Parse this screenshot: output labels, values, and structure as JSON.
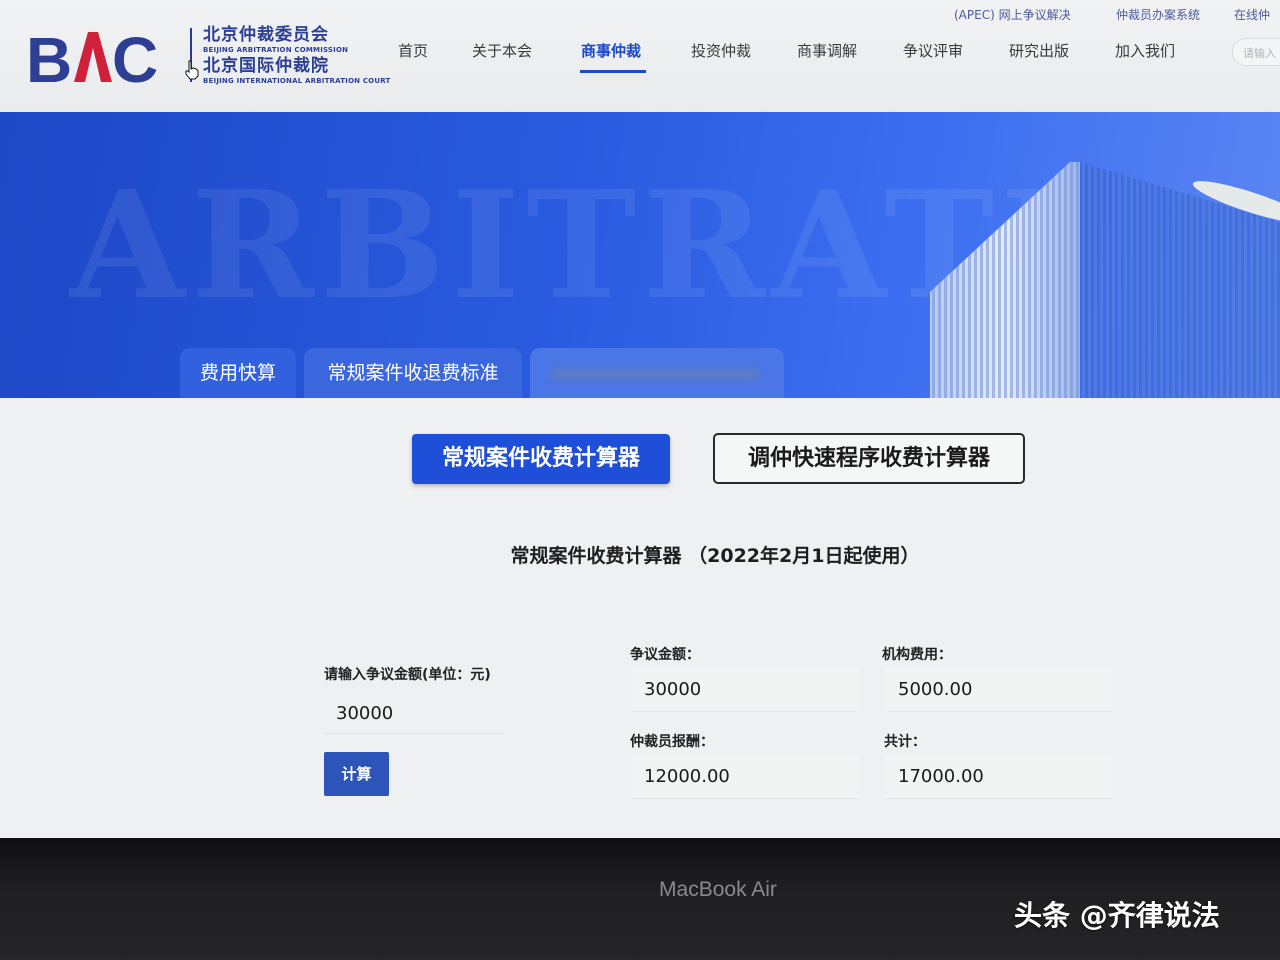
{
  "header": {
    "logo_mark": "BAC",
    "logo_cn_1": "北京仲裁委员会",
    "logo_en_1": "BEIJING ARBITRATION COMMISSION",
    "logo_cn_2": "北京国际仲裁院",
    "logo_en_2": "BEIJING INTERNATIONAL ARBITRATION COURT",
    "nav": [
      "首页",
      "关于本会",
      "商事仲裁",
      "投资仲裁",
      "商事调解",
      "争议评审",
      "研究出版",
      "加入我们"
    ],
    "nav_active": "商事仲裁",
    "top_links": [
      "(APEC) 网上争议解决",
      "仲裁员办案系统",
      "在线仲"
    ],
    "search_placeholder": "请输入"
  },
  "banner": {
    "watermark": "ARBITRATI",
    "tabs": [
      "费用快算",
      "常规案件收退费标准",
      ""
    ]
  },
  "calculator": {
    "btn_regular": "常规案件收费计算器",
    "btn_mediation": "调仲快速程序收费计算器",
    "title": "常规案件收费计算器 （2022年2月1日起使用）",
    "input_label": "请输入争议金额(单位：元)",
    "input_value": "30000",
    "calc_button": "计算",
    "dispute_label": "争议金额：",
    "dispute_value": "30000",
    "inst_fee_label": "机构费用：",
    "inst_fee_value": "5000.00",
    "arb_fee_label": "仲裁员报酬：",
    "arb_fee_value": "12000.00",
    "total_label": "共计：",
    "total_value": "17000.00"
  },
  "device": {
    "label": "MacBook Air",
    "credit": "头条 @齐律说法"
  },
  "colors": {
    "brand_blue": "#1f4ed8",
    "logo_navy": "#2d3f95",
    "logo_red": "#d0213b"
  }
}
